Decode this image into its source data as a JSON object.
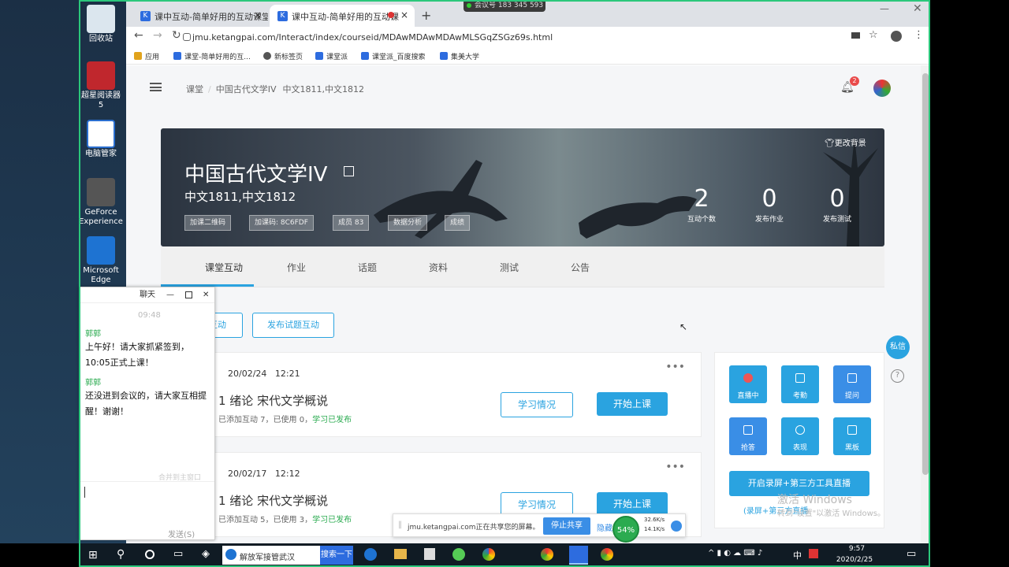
{
  "meeting_id": "会议号 183 345 593",
  "browser": {
    "tabs": [
      {
        "label": "课中互动-简单好用的互动课堂管"
      },
      {
        "label": "课中互动-简单好用的互动课"
      }
    ],
    "new_tab": "+",
    "url": "jmu.ketangpai.com/Interact/index/courseid/MDAwMDAwMDAwMLSGqZSGz69s.html",
    "bookmarks": [
      "应用",
      "课堂-简单好用的互...",
      "新标签页",
      "课堂派",
      "课堂派_百度搜索",
      "集美大学"
    ]
  },
  "header": {
    "breadcrumb": [
      "课堂",
      "中国古代文学IV",
      "中文1811,中文1812"
    ],
    "notification_count": "2"
  },
  "banner": {
    "course_title": "中国古代文学IV",
    "classes": "中文1811,中文1812",
    "change_bg": "更改背景",
    "buttons": [
      "加课二维码",
      "加课码: 8C6FDF",
      "成员 83",
      "数据分析",
      "成绩"
    ],
    "stats": [
      {
        "value": "2",
        "label": "互动个数"
      },
      {
        "value": "0",
        "label": "发布作业"
      },
      {
        "value": "0",
        "label": "发布测试"
      }
    ]
  },
  "tabs": [
    "课堂互动",
    "作业",
    "话题",
    "资料",
    "测试",
    "公告"
  ],
  "actions": {
    "partial": "互动",
    "publish_quiz": "发布试题互动"
  },
  "lessons": [
    {
      "date": "20/02/24",
      "time": "12:21",
      "title": "1 绪论 宋代文学概说",
      "status": "已添加互动 7，已使用 0，",
      "status_green": "学习已发布",
      "btn_study": "学习情况",
      "btn_start": "开始上课"
    },
    {
      "date": "20/02/17",
      "time": "12:12",
      "title": "1 绪论 宋代文学概说",
      "status": "已添加互动 5，已使用 3，",
      "status_green": "学习已发布",
      "btn_study": "学习情况",
      "btn_start": "开始上课"
    }
  ],
  "tools": [
    {
      "label": "直播中"
    },
    {
      "label": "考勤"
    },
    {
      "label": "提问"
    },
    {
      "label": "抢答"
    },
    {
      "label": "表现"
    },
    {
      "label": "黑板"
    }
  ],
  "record_btn": "开启录屏+第三方工具直播",
  "record_sub": "(录屏+第三方直播",
  "private_msg": "私信",
  "help": "?",
  "activate": {
    "line1": "激活 Windows",
    "line2": "转到\"设置\"以激活 Windows。"
  },
  "chat": {
    "title": "聊天",
    "time": "09:48",
    "messages": [
      {
        "name": "郭郭",
        "text": "上午好！请大家抓紧签到，10:05正式上课！"
      },
      {
        "name": "郭郭",
        "text": "还没进到会议的，请大家互相提醒！谢谢！"
      }
    ],
    "merge": "合并到主窗口",
    "send": "发送(S)"
  },
  "share": {
    "text": "jmu.ketangpai.com正在共享您的屏幕。",
    "stop": "停止共享",
    "hide": "隐藏",
    "cpu": "54%",
    "up": "32.6K/s",
    "down": "14.1K/s"
  },
  "desktop_icons": [
    "回收站",
    "超星阅读器5",
    "电脑管家",
    "GeForce Experience",
    "Microsoft Edge"
  ],
  "taskbar": {
    "search_text": "解放军接管武汉",
    "search_btn": "搜索一下",
    "ime": "中",
    "time": "9:57",
    "date": "2020/2/25"
  }
}
